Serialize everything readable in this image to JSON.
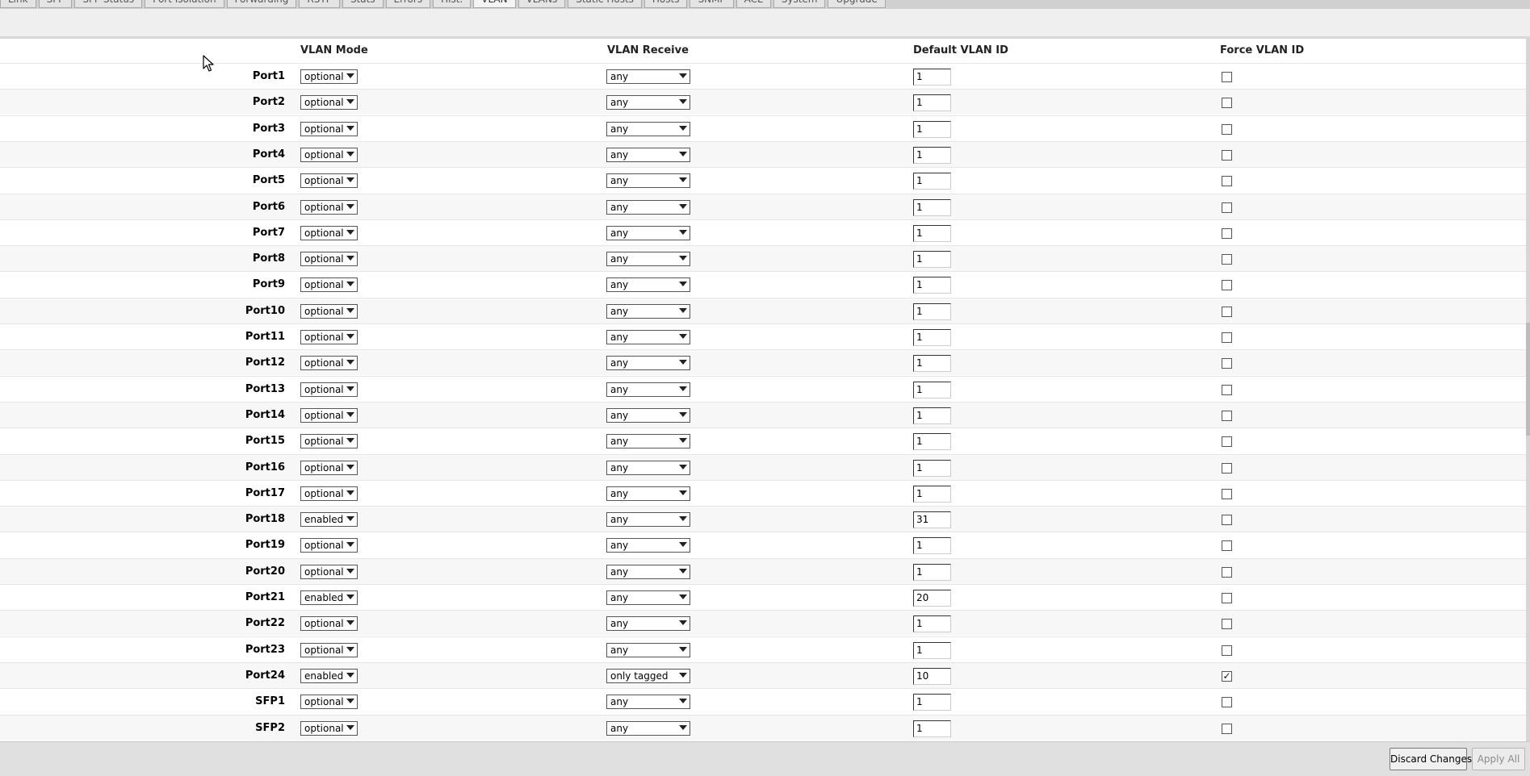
{
  "tabs": [
    {
      "label": "Link",
      "active": false
    },
    {
      "label": "SFP",
      "active": false
    },
    {
      "label": "SFP Status",
      "active": false
    },
    {
      "label": "Port Isolation",
      "active": false
    },
    {
      "label": "Forwarding",
      "active": false
    },
    {
      "label": "RSTP",
      "active": false
    },
    {
      "label": "Stats",
      "active": false
    },
    {
      "label": "Errors",
      "active": false
    },
    {
      "label": "Hist.",
      "active": false
    },
    {
      "label": "VLAN",
      "active": true
    },
    {
      "label": "VLANs",
      "active": false
    },
    {
      "label": "Static Hosts",
      "active": false
    },
    {
      "label": "Hosts",
      "active": false
    },
    {
      "label": "SNMP",
      "active": false
    },
    {
      "label": "ACL",
      "active": false
    },
    {
      "label": "System",
      "active": false
    },
    {
      "label": "Upgrade",
      "active": false
    }
  ],
  "table": {
    "headers": {
      "vlan_mode": "VLAN Mode",
      "vlan_receive": "VLAN Receive",
      "default_vlan_id": "Default VLAN ID",
      "force_vlan_id": "Force VLAN ID"
    },
    "rows": [
      {
        "port": "Port1",
        "mode": "optional",
        "receive": "any",
        "vid": "1",
        "force": false
      },
      {
        "port": "Port2",
        "mode": "optional",
        "receive": "any",
        "vid": "1",
        "force": false
      },
      {
        "port": "Port3",
        "mode": "optional",
        "receive": "any",
        "vid": "1",
        "force": false
      },
      {
        "port": "Port4",
        "mode": "optional",
        "receive": "any",
        "vid": "1",
        "force": false
      },
      {
        "port": "Port5",
        "mode": "optional",
        "receive": "any",
        "vid": "1",
        "force": false
      },
      {
        "port": "Port6",
        "mode": "optional",
        "receive": "any",
        "vid": "1",
        "force": false
      },
      {
        "port": "Port7",
        "mode": "optional",
        "receive": "any",
        "vid": "1",
        "force": false
      },
      {
        "port": "Port8",
        "mode": "optional",
        "receive": "any",
        "vid": "1",
        "force": false
      },
      {
        "port": "Port9",
        "mode": "optional",
        "receive": "any",
        "vid": "1",
        "force": false
      },
      {
        "port": "Port10",
        "mode": "optional",
        "receive": "any",
        "vid": "1",
        "force": false
      },
      {
        "port": "Port11",
        "mode": "optional",
        "receive": "any",
        "vid": "1",
        "force": false
      },
      {
        "port": "Port12",
        "mode": "optional",
        "receive": "any",
        "vid": "1",
        "force": false
      },
      {
        "port": "Port13",
        "mode": "optional",
        "receive": "any",
        "vid": "1",
        "force": false
      },
      {
        "port": "Port14",
        "mode": "optional",
        "receive": "any",
        "vid": "1",
        "force": false
      },
      {
        "port": "Port15",
        "mode": "optional",
        "receive": "any",
        "vid": "1",
        "force": false
      },
      {
        "port": "Port16",
        "mode": "optional",
        "receive": "any",
        "vid": "1",
        "force": false
      },
      {
        "port": "Port17",
        "mode": "optional",
        "receive": "any",
        "vid": "1",
        "force": false
      },
      {
        "port": "Port18",
        "mode": "enabled",
        "receive": "any",
        "vid": "31",
        "force": false
      },
      {
        "port": "Port19",
        "mode": "optional",
        "receive": "any",
        "vid": "1",
        "force": false
      },
      {
        "port": "Port20",
        "mode": "optional",
        "receive": "any",
        "vid": "1",
        "force": false
      },
      {
        "port": "Port21",
        "mode": "enabled",
        "receive": "any",
        "vid": "20",
        "force": false
      },
      {
        "port": "Port22",
        "mode": "optional",
        "receive": "any",
        "vid": "1",
        "force": false
      },
      {
        "port": "Port23",
        "mode": "optional",
        "receive": "any",
        "vid": "1",
        "force": false
      },
      {
        "port": "Port24",
        "mode": "enabled",
        "receive": "only tagged",
        "vid": "10",
        "force": true
      },
      {
        "port": "SFP1",
        "mode": "optional",
        "receive": "any",
        "vid": "1",
        "force": false
      },
      {
        "port": "SFP2",
        "mode": "optional",
        "receive": "any",
        "vid": "1",
        "force": false
      }
    ]
  },
  "footer": {
    "discard_label": "Discard Changes",
    "apply_label": "Apply All"
  },
  "icons": {
    "checkmark": "✓",
    "select_arrow": "chevron-down-icon",
    "cursor": "mouse-pointer-icon"
  }
}
